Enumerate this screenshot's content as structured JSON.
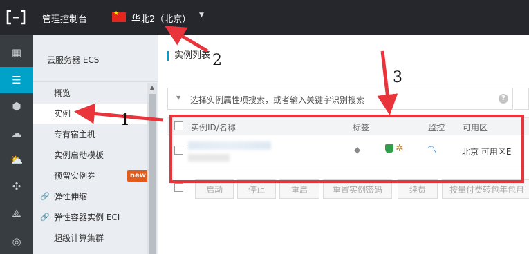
{
  "topbar": {
    "console_title": "管理控制台",
    "region": "华北2（北京）"
  },
  "rail": {
    "items": [
      {
        "icon": "apps-grid-icon",
        "glyph": "▦"
      },
      {
        "icon": "list-icon",
        "glyph": "☰",
        "active": true
      },
      {
        "icon": "cluster-icon",
        "glyph": "⬢"
      },
      {
        "icon": "cloud-icon",
        "glyph": "☁"
      },
      {
        "icon": "cloud-upload-icon",
        "glyph": "⛅"
      },
      {
        "icon": "network-icon",
        "glyph": "✣"
      },
      {
        "icon": "share-icon",
        "glyph": "⟁"
      },
      {
        "icon": "globe-icon",
        "glyph": "◎"
      }
    ]
  },
  "subnav": {
    "title": "云服务器 ECS",
    "items": [
      {
        "label": "概览"
      },
      {
        "label": "实例",
        "active": true
      },
      {
        "label": "专有宿主机"
      },
      {
        "label": "实例启动模板"
      },
      {
        "label": "预留实例券",
        "badge": "new"
      },
      {
        "label": "弹性伸缩",
        "link": true
      },
      {
        "label": "弹性容器实例 ECI",
        "link": true
      },
      {
        "label": "超级计算集群"
      }
    ]
  },
  "main": {
    "title": "实例列表",
    "search_placeholder": "选择实例属性项搜索，或者输入关键字识别搜索",
    "help": "?",
    "columns": [
      "实例ID/名称",
      "标签",
      "监控",
      "可用区"
    ],
    "row": {
      "zone": "北京 可用区E"
    },
    "actions": [
      "启动",
      "停止",
      "重启",
      "重置实例密码",
      "续费",
      "按量付费转包年包月"
    ]
  },
  "annotations": {
    "n1": "1",
    "n2": "2",
    "n3": "3",
    "color": "#e8343a"
  }
}
